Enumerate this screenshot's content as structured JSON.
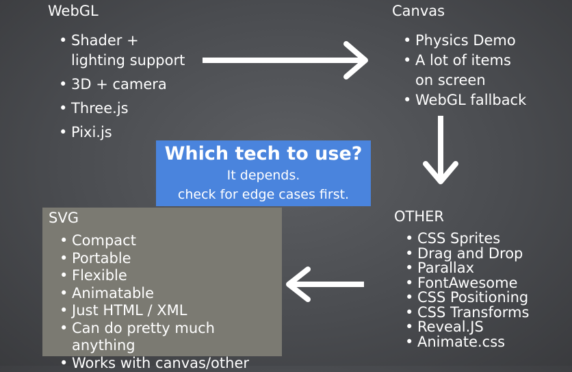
{
  "webgl": {
    "title": "WebGL",
    "items": [
      "Shader +\nlighting support",
      "3D + camera",
      "Three.js",
      "Pixi.js"
    ]
  },
  "canvas": {
    "title": "Canvas",
    "items": [
      "Physics Demo",
      "A lot of items\non screen",
      "WebGL fallback"
    ]
  },
  "center": {
    "headline": "Which tech to use?",
    "line1": "It depends.",
    "line2": "check for edge cases first.",
    "color": "#4a84dd"
  },
  "svg": {
    "title": "SVG",
    "items": [
      "Compact",
      "Portable",
      "Flexible",
      "Animatable",
      "Just HTML / XML",
      "Can do pretty much anything",
      "Works with canvas/other"
    ],
    "box_color": "#7b7a72"
  },
  "other": {
    "title": "OTHER",
    "items": [
      "CSS Sprites",
      "Drag and Drop",
      "Parallax",
      "FontAwesome",
      "CSS Positioning",
      "CSS Transforms",
      "Reveal.JS",
      "Animate.css"
    ]
  },
  "bullet_char": "•",
  "arrows": [
    "webgl-to-canvas",
    "canvas-to-other",
    "other-to-svg"
  ]
}
